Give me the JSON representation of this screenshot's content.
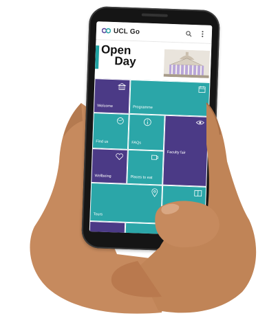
{
  "app": {
    "title": "UCL Go"
  },
  "header_icons": [
    "search-icon",
    "more-vert-icon"
  ],
  "banner": {
    "line1": "Open",
    "line2": "Day"
  },
  "tiles": [
    {
      "label": "Welcome",
      "icon": "building-icon",
      "color": "#4b3a86"
    },
    {
      "label": "Programme",
      "icon": "calendar-icon",
      "color": "#2ba6a8"
    },
    {
      "label": "Find us",
      "icon": "map-icon",
      "color": "#2ba6a8"
    },
    {
      "label": "FAQs",
      "icon": "info-icon",
      "color": "#2ba6a8"
    },
    {
      "label": "Faculty fair",
      "icon": "eye-icon",
      "color": "#4b3a86"
    },
    {
      "label": "Wellbeing",
      "icon": "heart-icon",
      "color": "#4b3a86"
    },
    {
      "label": "Places to eat",
      "icon": "cup-icon",
      "color": "#2ba6a8"
    },
    {
      "label": "Tours",
      "icon": "location-pin-icon",
      "color": "#2ba6a8"
    },
    {
      "label": "",
      "icon": "book-icon",
      "color": "#2ba6a8"
    }
  ],
  "colors": {
    "teal": "#2ba6a8",
    "purple": "#4b3a86",
    "skin": "#c68a5e"
  }
}
